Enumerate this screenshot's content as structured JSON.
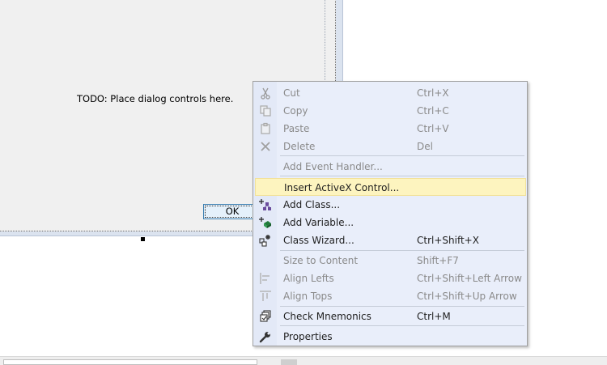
{
  "dialog": {
    "placeholder_text": "TODO: Place dialog controls here.",
    "ok_label": "OK"
  },
  "context_menu": {
    "items": [
      {
        "label": "Cut",
        "shortcut": "Ctrl+X",
        "icon": "cut-icon",
        "enabled": false
      },
      {
        "label": "Copy",
        "shortcut": "Ctrl+C",
        "icon": "copy-icon",
        "enabled": false
      },
      {
        "label": "Paste",
        "shortcut": "Ctrl+V",
        "icon": "paste-icon",
        "enabled": false
      },
      {
        "label": "Delete",
        "shortcut": "Del",
        "icon": "delete-icon",
        "enabled": false
      },
      {
        "label": "Add Event Handler...",
        "shortcut": "",
        "icon": "",
        "enabled": false
      },
      {
        "label": "Insert ActiveX Control...",
        "shortcut": "",
        "icon": "",
        "enabled": true,
        "highlighted": true
      },
      {
        "label": "Add Class...",
        "shortcut": "",
        "icon": "add-class-icon",
        "enabled": true
      },
      {
        "label": "Add Variable...",
        "shortcut": "",
        "icon": "add-variable-icon",
        "enabled": true
      },
      {
        "label": "Class Wizard...",
        "shortcut": "Ctrl+Shift+X",
        "icon": "class-wizard-icon",
        "enabled": true
      },
      {
        "label": "Size to Content",
        "shortcut": "Shift+F7",
        "icon": "",
        "enabled": false
      },
      {
        "label": "Align Lefts",
        "shortcut": "Ctrl+Shift+Left Arrow",
        "icon": "align-lefts-icon",
        "enabled": false
      },
      {
        "label": "Align Tops",
        "shortcut": "Ctrl+Shift+Up Arrow",
        "icon": "align-tops-icon",
        "enabled": false
      },
      {
        "label": "Check Mnemonics",
        "shortcut": "Ctrl+M",
        "icon": "check-mnemonics-icon",
        "enabled": true
      },
      {
        "label": "Properties",
        "shortcut": "",
        "icon": "wrench-icon",
        "enabled": true
      }
    ]
  },
  "colors": {
    "menu_background": "#e9eefa",
    "highlight": "#fdf4bf",
    "disabled_text": "#8a8a8a"
  }
}
